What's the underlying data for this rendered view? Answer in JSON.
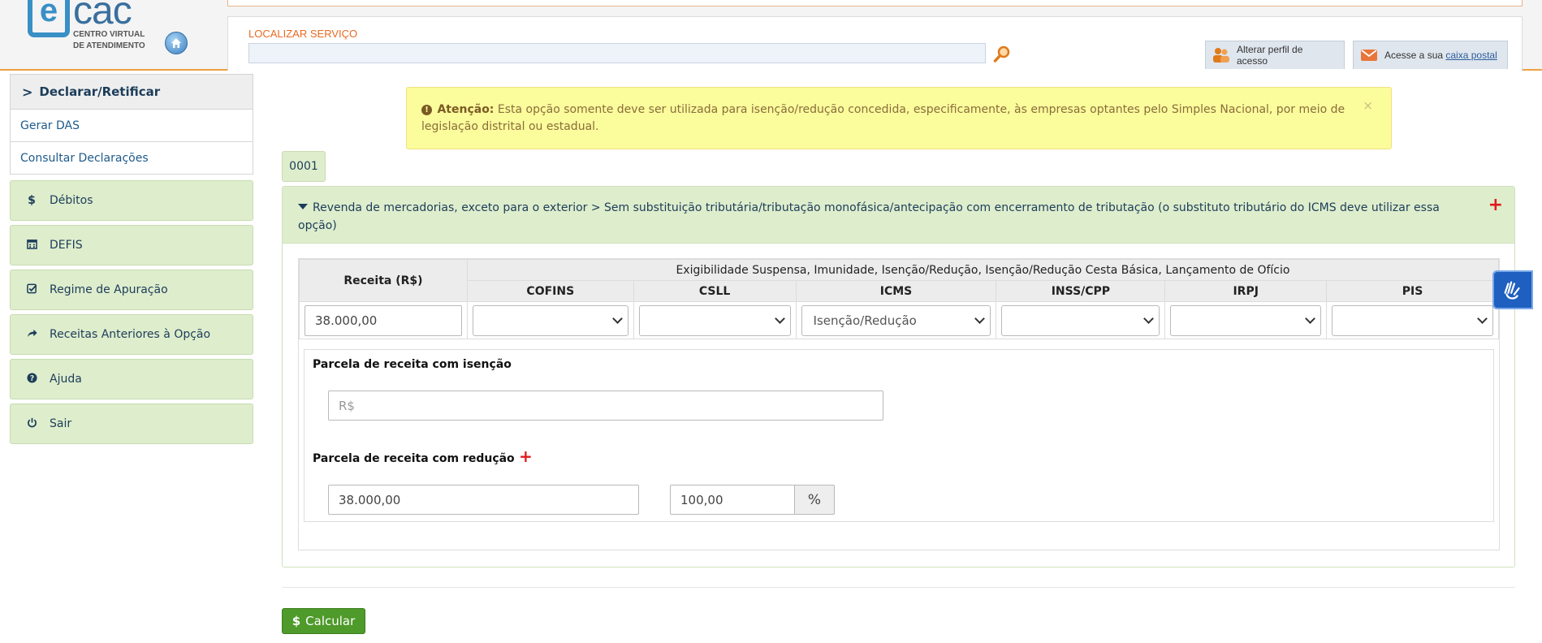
{
  "header": {
    "logo": {
      "letter": "e",
      "name": "cac",
      "subtitle_line1": "CENTRO VIRTUAL",
      "subtitle_line2": "DE ATENDIMENTO"
    },
    "locate_label": "LOCALIZAR SERVIÇO",
    "locate_value": "",
    "profile_button": "Alterar perfil de acesso",
    "mailbox_prefix": "Acesse a sua ",
    "mailbox_link": "caixa postal"
  },
  "sidebar": {
    "section_title": "Declarar/Retificar",
    "sub_items": [
      "Gerar DAS",
      "Consultar Declarações"
    ],
    "items": [
      {
        "icon": "dollar-icon",
        "glyph": "$",
        "label": "Débitos"
      },
      {
        "icon": "calendar-icon",
        "glyph": "▦",
        "label": "DEFIS"
      },
      {
        "icon": "check-square-icon",
        "glyph": "☑",
        "label": "Regime de Apuração"
      },
      {
        "icon": "share-arrow-icon",
        "glyph": "➦",
        "label": "Receitas Anteriores à Opção"
      },
      {
        "icon": "question-circle-icon",
        "glyph": "?",
        "label": "Ajuda"
      },
      {
        "icon": "power-icon",
        "glyph": "⏻",
        "label": "Sair"
      }
    ]
  },
  "alert": {
    "title": "Atenção:",
    "message": " Esta opção somente deve ser utilizada para isenção/redução concedida, especificamente, às empresas optantes pelo Simples Nacional, por meio de legislação distrital ou estadual.",
    "close": "×"
  },
  "establishment_tab": "0001",
  "activity": {
    "title": "Revenda de mercadorias, exceto para o exterior > Sem substituição tributária/tributação monofásica/antecipação com encerramento de tributação (o substituto tributário do ICMS deve utilizar essa opção)",
    "expand_symbol": "+"
  },
  "table": {
    "revenue_header": "Receita (R$)",
    "group_header": "Exigibilidade Suspensa, Imunidade, Isenção/Redução, Isenção/Redução Cesta Básica, Lançamento de Ofício",
    "columns": [
      "COFINS",
      "CSLL",
      "ICMS",
      "INSS/CPP",
      "IRPJ",
      "PIS"
    ],
    "revenue_value": "38.000,00",
    "selects": [
      "",
      "",
      "Isenção/Redução",
      "",
      "",
      ""
    ]
  },
  "details": {
    "exemption_label": "Parcela de receita com isenção",
    "exemption_placeholder": "R$",
    "reduction_label": "Parcela de receita com redução",
    "reduction_add": "+",
    "reduction_value": "38.000,00",
    "reduction_percent": "100,00",
    "percent_symbol": "%"
  },
  "actions": {
    "calculate_icon": "$",
    "calculate": "Calcular"
  },
  "colors": {
    "accent_green": "#deedcc",
    "button_green": "#4e9a2a",
    "alert_yellow": "#fbfc9c",
    "header_orange": "#e96a22"
  }
}
